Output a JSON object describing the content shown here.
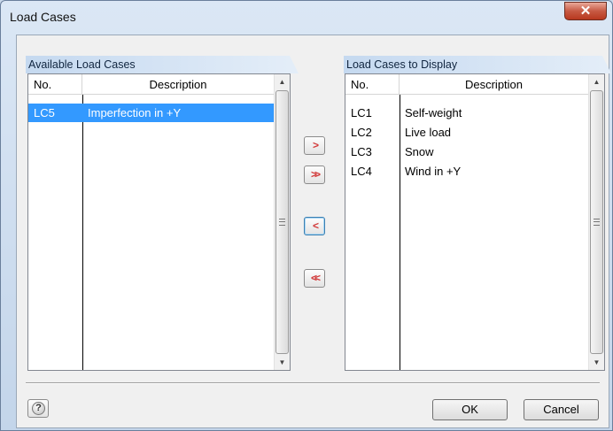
{
  "window": {
    "title": "Load Cases",
    "close_symbol": "✕"
  },
  "available": {
    "header": "Available Load Cases",
    "columns": {
      "no": "No.",
      "description": "Description"
    },
    "rows": [
      {
        "no": "LC5",
        "description": "Imperfection in +Y",
        "selected": true
      }
    ]
  },
  "display": {
    "header": "Load Cases to Display",
    "columns": {
      "no": "No.",
      "description": "Description"
    },
    "rows": [
      {
        "no": "LC1",
        "description": "Self-weight"
      },
      {
        "no": "LC2",
        "description": "Live load"
      },
      {
        "no": "LC3",
        "description": "Snow"
      },
      {
        "no": "LC4",
        "description": "Wind in +Y"
      }
    ]
  },
  "transfer": {
    "move_right": ">",
    "move_all_right": ">>",
    "move_left": "<",
    "move_all_left": "<<"
  },
  "scroll": {
    "up": "▲",
    "down": "▼"
  },
  "footer": {
    "help_symbol": "?",
    "ok_label": "OK",
    "cancel_label": "Cancel"
  },
  "colors": {
    "selection": "#3399ff",
    "arrow_red": "#d23a3a",
    "close_red": "#c75a44"
  }
}
